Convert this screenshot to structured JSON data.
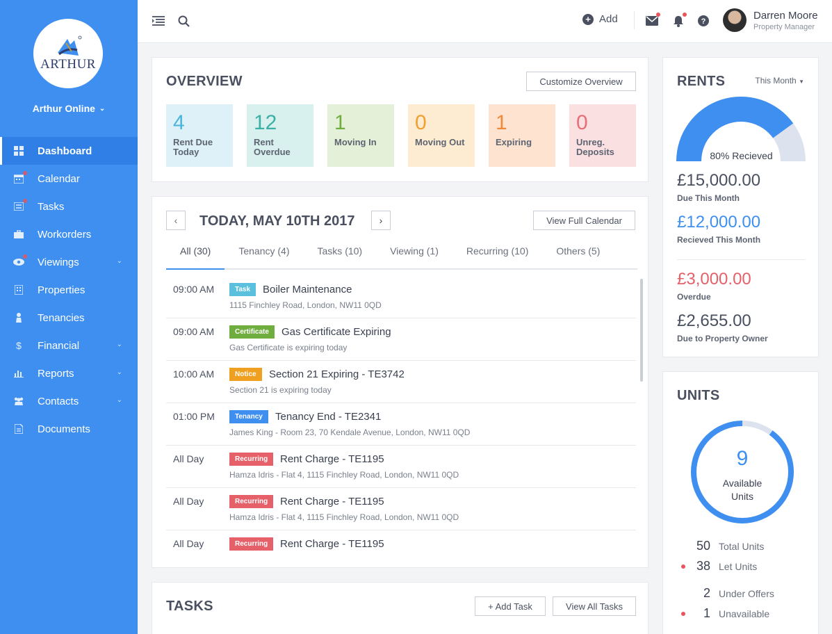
{
  "sidebar": {
    "logo_text": "ARTHUR",
    "org_name": "Arthur Online",
    "items": [
      {
        "label": "Dashboard",
        "icon": "grid-icon",
        "active": true
      },
      {
        "label": "Calendar",
        "icon": "calendar-icon",
        "dot": true
      },
      {
        "label": "Tasks",
        "icon": "tasks-icon",
        "dot": true
      },
      {
        "label": "Workorders",
        "icon": "briefcase-icon"
      },
      {
        "label": "Viewings",
        "icon": "eye-icon",
        "dot": true,
        "caret": true
      },
      {
        "label": "Properties",
        "icon": "building-icon"
      },
      {
        "label": "Tenancies",
        "icon": "person-icon"
      },
      {
        "label": "Financial",
        "icon": "dollar-icon",
        "caret": true
      },
      {
        "label": "Reports",
        "icon": "bar-chart-icon",
        "caret": true
      },
      {
        "label": "Contacts",
        "icon": "people-icon",
        "caret": true
      },
      {
        "label": "Documents",
        "icon": "document-icon"
      }
    ]
  },
  "topbar": {
    "add_label": "Add",
    "user_name": "Darren Moore",
    "user_role": "Property Manager"
  },
  "overview": {
    "title": "OVERVIEW",
    "customize_label": "Customize Overview",
    "tiles": [
      {
        "value": "4",
        "label": "Rent Due Today",
        "bg": "#dff1f8",
        "color": "#4ab4dc"
      },
      {
        "value": "12",
        "label": "Rent Overdue",
        "bg": "#d8f1ef",
        "color": "#3cb0a4"
      },
      {
        "value": "1",
        "label": "Moving In",
        "bg": "#e4f0d8",
        "color": "#6fad3f"
      },
      {
        "value": "0",
        "label": "Moving Out",
        "bg": "#fdecd2",
        "color": "#f0a030"
      },
      {
        "value": "1",
        "label": "Expiring",
        "bg": "#fde3d0",
        "color": "#f08a3a"
      },
      {
        "value": "0",
        "label": "Unreg. Deposits",
        "bg": "#fbe0e2",
        "color": "#e6707a"
      }
    ]
  },
  "calendar": {
    "date": "TODAY, MAY 10TH 2017",
    "view_full_label": "View Full Calendar",
    "tabs": [
      "All (30)",
      "Tenancy (4)",
      "Tasks (10)",
      "Viewing (1)",
      "Recurring (10)",
      "Others (5)"
    ],
    "events": [
      {
        "time": "09:00 AM",
        "tag": "Task",
        "tag_color": "#5bc0de",
        "title": "Boiler Maintenance",
        "sub": "1115 Finchley Road, London, NW11 0QD"
      },
      {
        "time": "09:00 AM",
        "tag": "Certificate",
        "tag_color": "#6fad3f",
        "title": "Gas Certificate Expiring",
        "sub": "Gas Certificate is expiring today"
      },
      {
        "time": "10:00 AM",
        "tag": "Notice",
        "tag_color": "#f0a020",
        "title": "Section 21 Expiring - TE3742",
        "sub": "Section 21 is expiring today"
      },
      {
        "time": "01:00 PM",
        "tag": "Tenancy",
        "tag_color": "#3e8ff0",
        "title": "Tenancy End - TE2341",
        "sub": "James King - Room 23, 70 Kendale Avenue, London, NW11 0QD"
      },
      {
        "time": "All Day",
        "tag": "Recurring",
        "tag_color": "#e6606a",
        "title": "Rent Charge - TE1195",
        "sub": "Hamza Idris - Flat 4, 1115 Finchley Road, London, NW11 0QD"
      },
      {
        "time": "All Day",
        "tag": "Recurring",
        "tag_color": "#e6606a",
        "title": "Rent Charge - TE1195",
        "sub": "Hamza Idris - Flat 4, 1115 Finchley Road, London, NW11 0QD"
      },
      {
        "time": "All Day",
        "tag": "Recurring",
        "tag_color": "#e6606a",
        "title": "Rent Charge - TE1195",
        "sub": ""
      }
    ]
  },
  "tasks": {
    "title": "TASKS",
    "add_label": "+ Add Task",
    "view_all_label": "View All Tasks"
  },
  "rents": {
    "title": "RENTS",
    "filter": "This Month",
    "gauge_percent": 80,
    "gauge_label": "80% Recieved",
    "due": "£15,000.00",
    "due_label": "Due This Month",
    "received": "£12,000.00",
    "received_label": "Recieved This Month",
    "overdue": "£3,000.00",
    "overdue_label": "Overdue",
    "owner": "£2,655.00",
    "owner_label": "Due to Property Owner"
  },
  "units": {
    "title": "UNITS",
    "available": "9",
    "available_label": "Available Units",
    "ring_fraction": 0.9,
    "rows": [
      {
        "num": "50",
        "label": "Total Units",
        "dot": false
      },
      {
        "num": "38",
        "label": "Let Units",
        "dot": true
      },
      {
        "num": "2",
        "label": "Under Offers",
        "dot": false
      },
      {
        "num": "1",
        "label": "Unavailable",
        "dot": true
      }
    ]
  },
  "colors": {
    "accent": "#3e8ff0",
    "danger": "#e6606a"
  }
}
